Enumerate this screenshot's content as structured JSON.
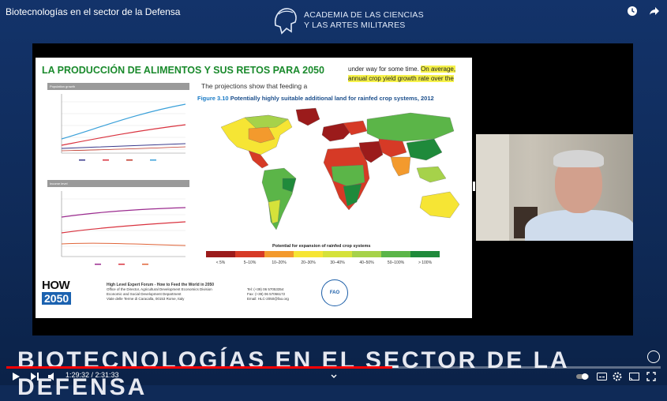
{
  "video": {
    "title": "Biotecnologías en el sector de la Defensa",
    "channel_logo_line1": "ACADEMIA DE LAS CIENCIAS",
    "channel_logo_line2": "Y LAS ARTES MILITARES",
    "banner": "BIOTECNOLOGÍAS EN EL SECTOR DE LA DEFENSA",
    "time_current": "1:29:32",
    "time_total": "2:31:33",
    "time_display": "1:29:32 / 2:31:33",
    "progress": 0.59
  },
  "slide": {
    "title": "LA PRODUCCIÓN DE ALIMENTOS Y SUS RETOS PARA 2050",
    "text_right_1": "under way for some time. ",
    "text_right_hl1": "On average,",
    "text_right_hl2": "annual crop yield growth rate over the",
    "projections": "The projections show that feeding a",
    "figure_number": "Figure 3.10",
    "figure_title": "Potentially highly suitable additional land for rainfed crop systems, 2012",
    "chart1_title": "Population growth",
    "chart2_title": "Income level",
    "legend_title": "Potential for expansion of rainfed crop systems",
    "legend": [
      {
        "label": "< 5%",
        "color": "#9b1b1b"
      },
      {
        "label": "5–10%",
        "color": "#d63a26"
      },
      {
        "label": "10–20%",
        "color": "#f39a2d"
      },
      {
        "label": "20–30%",
        "color": "#f6e534"
      },
      {
        "label": "30–40%",
        "color": "#d5e23a"
      },
      {
        "label": "40–50%",
        "color": "#a6d24a"
      },
      {
        "label": "50–100%",
        "color": "#5bb548"
      },
      {
        "label": "> 100%",
        "color": "#1f8a3b"
      }
    ],
    "logo_how": "HOW",
    "logo_year": "2050",
    "forum_title": "High Level Expert Forum - How to Feed the World in 2050",
    "forum_line2": "Office of the Director, Agricultural Development Economics Division",
    "forum_line3": "Economic and Social Development Department",
    "forum_line4": "Viale delle Terme di Caracalla, 00153 Rome, Italy",
    "contact_tel": "Tel: (+39) 06 57053354",
    "contact_fax": "Fax: (+39) 06 57056172",
    "contact_email": "Email: HLC-2050@fao.org",
    "fao": "FAO"
  }
}
